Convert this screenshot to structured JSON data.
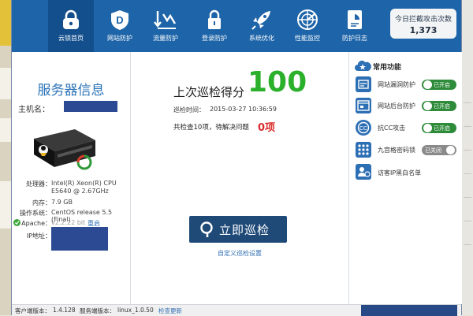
{
  "nav": {
    "items": [
      {
        "label": "云锁首页",
        "icon": "lock-icon"
      },
      {
        "label": "网站防护",
        "icon": "shield-d-icon"
      },
      {
        "label": "流量防护",
        "icon": "traffic-arrows-icon"
      },
      {
        "label": "登录防护",
        "icon": "padlock-icon"
      },
      {
        "label": "系统优化",
        "icon": "rocket-icon"
      },
      {
        "label": "性能监控",
        "icon": "radar-icon"
      },
      {
        "label": "防护日志",
        "icon": "log-document-icon"
      }
    ],
    "attack_label": "今日拦截攻击次数",
    "attack_count": "1,373"
  },
  "server": {
    "title": "服务器信息",
    "hostname_label": "主机名：",
    "cpu_label": "处理器：",
    "cpu_value_1": "Intel(R) Xeon(R) CPU",
    "cpu_value_2": "E5640  @ 2.67GHz",
    "memory_label": "内存：",
    "memory_value": "7.9 GB",
    "os_label": "操作系统：",
    "os_value": "CentOS release 5.5 (Final)",
    "apache_label": "Apache：",
    "apache_value": "v2.2.22 bit",
    "apache_link": "重启",
    "ip_label": "IP地址："
  },
  "scan": {
    "score_label": "上次巡检得分",
    "score_value": "100",
    "time_label": "巡检时间：",
    "time_value": "2015-03-27 10:36:59",
    "issues_text": "共检查10项，待解决问题",
    "issues_count": "0项",
    "button_label": "立即巡检",
    "custom_link": "自定义巡检设置"
  },
  "features": {
    "title": "常用功能",
    "items": [
      {
        "label": "网站漏洞防护",
        "toggle": "已开启",
        "on": true
      },
      {
        "label": "网站后台防护",
        "toggle": "已开启",
        "on": true
      },
      {
        "label": "抗CC攻击",
        "toggle": "已开启",
        "on": true
      },
      {
        "label": "九宫格密码锁",
        "toggle": "已关闭",
        "on": false
      },
      {
        "label": "访客IP黑白名单",
        "toggle": "",
        "on": null
      }
    ]
  },
  "status": {
    "client_version_label": "客户端版本：",
    "client_version": "1.4.128",
    "server_version_label": "服务端版本：",
    "server_version": "linux_1.0.50",
    "update_link": "检查更新"
  },
  "colors": {
    "topbar": "#1d64a8",
    "score_green": "#2bb02b",
    "issue_red": "#d92b2b",
    "toggle_on": "#2e8b3a",
    "toggle_off": "#8a8a8a",
    "primary_button": "#1f4a78"
  }
}
